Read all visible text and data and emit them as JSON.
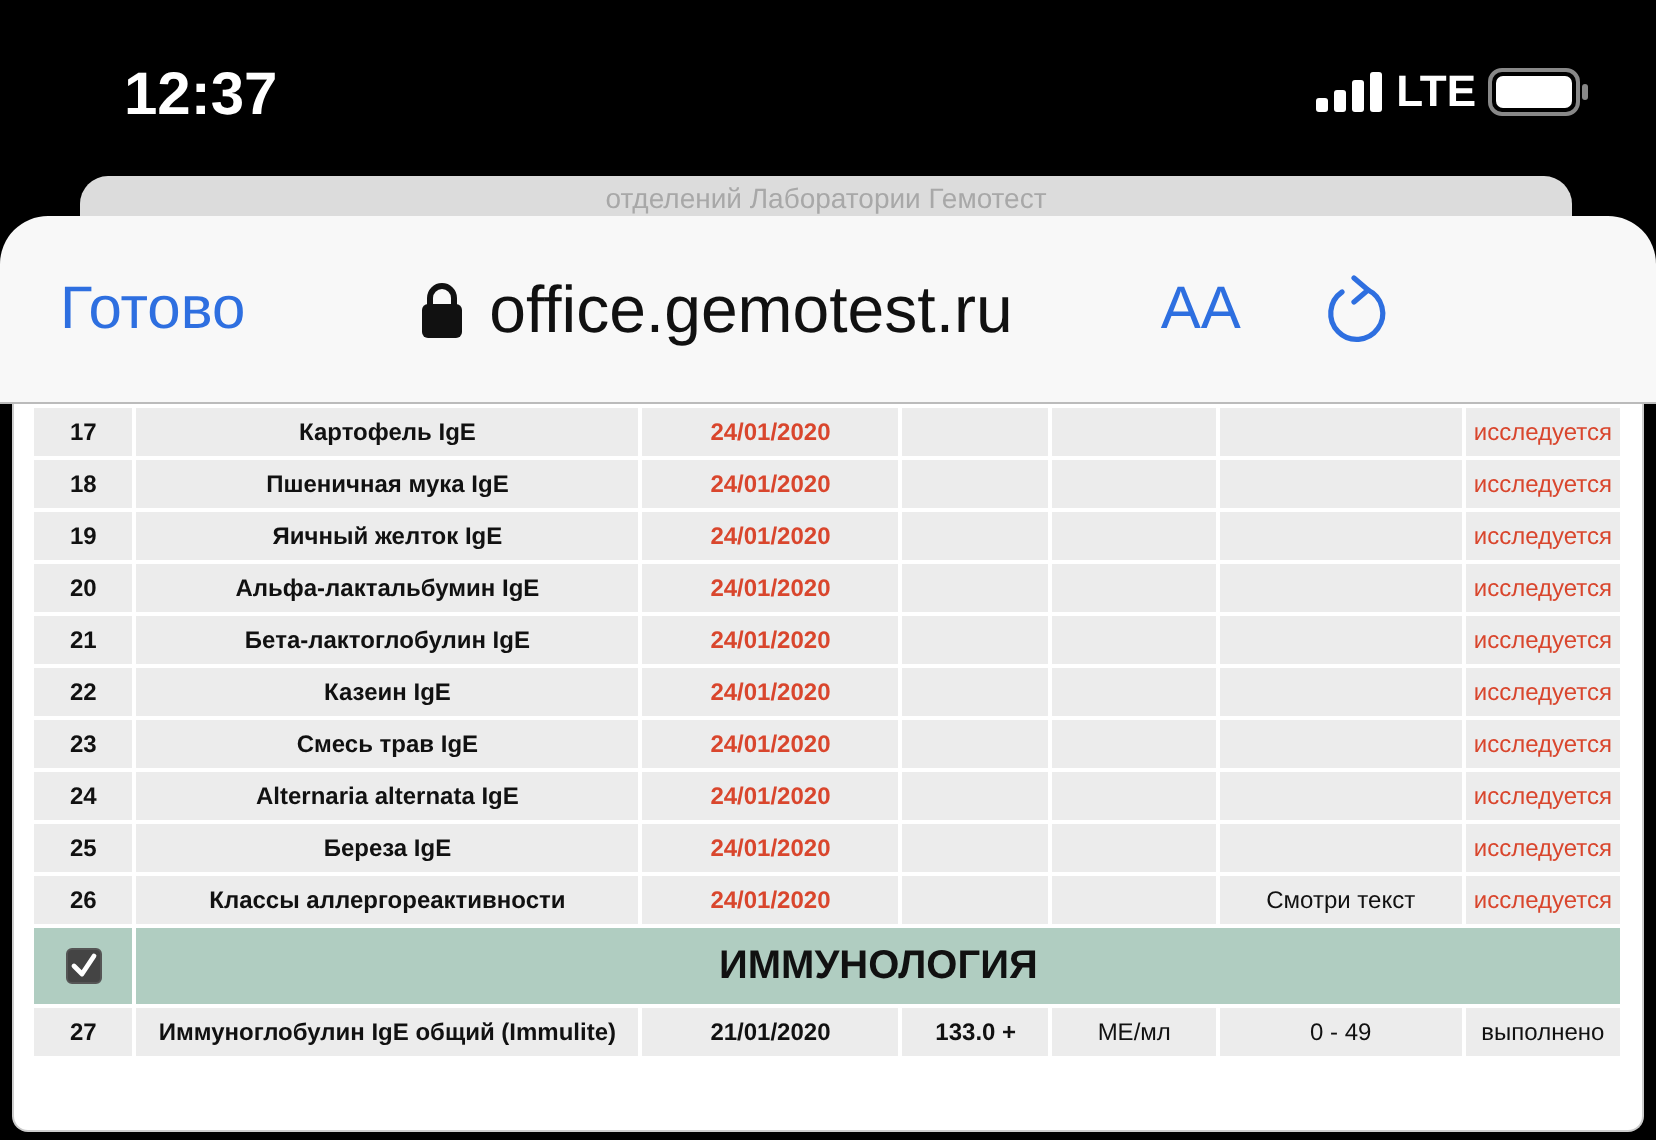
{
  "status_bar": {
    "time": "12:37",
    "network": "LTE"
  },
  "background_tab": {
    "title": "отделений Лаборатории Гемотест"
  },
  "browser_bar": {
    "done": "Готово",
    "url": "office.gemotest.ru",
    "text_size": "AA"
  },
  "table": {
    "items": [
      {
        "kind": "test",
        "number": "17",
        "name": "Картофель IgE",
        "date": "24/01/2020",
        "status": "исследуется",
        "pending": true
      },
      {
        "kind": "test",
        "number": "18",
        "name": "Пшеничная мука IgE",
        "date": "24/01/2020",
        "status": "исследуется",
        "pending": true
      },
      {
        "kind": "test",
        "number": "19",
        "name": "Яичный желток IgE",
        "date": "24/01/2020",
        "status": "исследуется",
        "pending": true
      },
      {
        "kind": "test",
        "number": "20",
        "name": "Альфа-лактальбумин IgE",
        "date": "24/01/2020",
        "status": "исследуется",
        "pending": true
      },
      {
        "kind": "test",
        "number": "21",
        "name": "Бета-лактоглобулин IgE",
        "date": "24/01/2020",
        "status": "исследуется",
        "pending": true
      },
      {
        "kind": "test",
        "number": "22",
        "name": "Казеин IgE",
        "date": "24/01/2020",
        "status": "исследуется",
        "pending": true
      },
      {
        "kind": "test",
        "number": "23",
        "name": "Смесь трав IgE",
        "date": "24/01/2020",
        "status": "исследуется",
        "pending": true
      },
      {
        "kind": "test",
        "number": "24",
        "name": "Alternaria alternata IgE",
        "date": "24/01/2020",
        "status": "исследуется",
        "pending": true
      },
      {
        "kind": "test",
        "number": "25",
        "name": "Береза IgE",
        "date": "24/01/2020",
        "status": "исследуется",
        "pending": true
      },
      {
        "kind": "test",
        "number": "26",
        "name": "Классы аллергореактивности",
        "date": "24/01/2020",
        "reference": "Смотри текст",
        "status": "исследуется",
        "pending": true
      },
      {
        "kind": "section",
        "title": "ИММУНОЛОГИЯ",
        "checked": true
      },
      {
        "kind": "test",
        "number": "27",
        "name": "Иммуноглобулин IgE общий (Immulite)",
        "date": "21/01/2020",
        "result": "133.0 +",
        "units": "МЕ/мл",
        "reference": "0 - 49",
        "status": "выполнено",
        "pending": false
      }
    ]
  }
}
